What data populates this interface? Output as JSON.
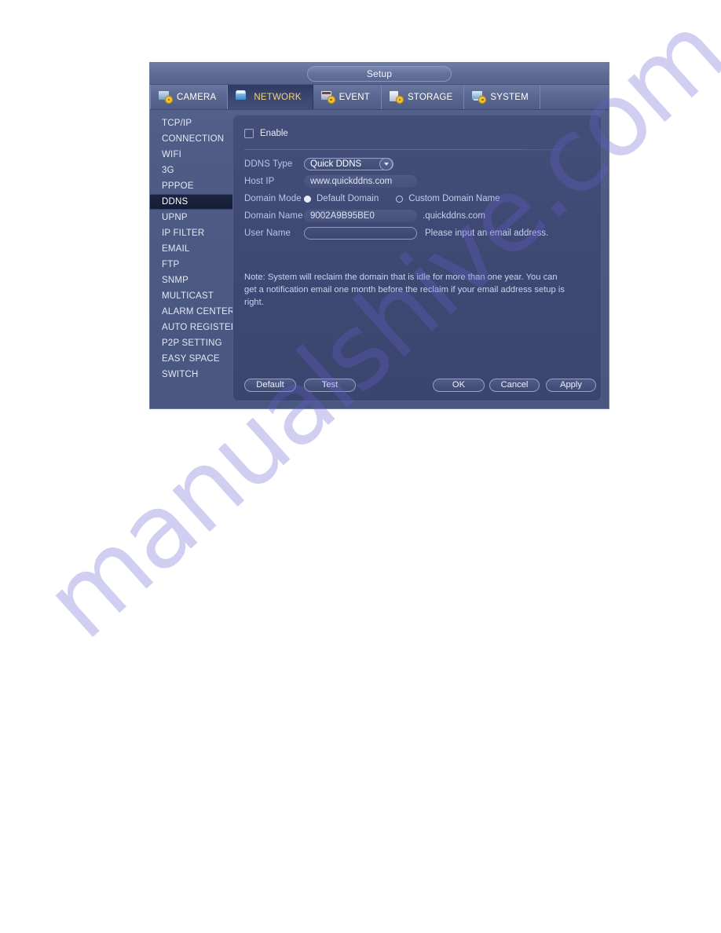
{
  "window": {
    "title": "Setup"
  },
  "tabs": [
    {
      "label": "CAMERA",
      "icon": "camera-icon",
      "active": false
    },
    {
      "label": "NETWORK",
      "icon": "network-icon",
      "active": true
    },
    {
      "label": "EVENT",
      "icon": "event-icon",
      "active": false
    },
    {
      "label": "STORAGE",
      "icon": "storage-icon",
      "active": false
    },
    {
      "label": "SYSTEM",
      "icon": "system-icon",
      "active": false
    }
  ],
  "sidebar": {
    "items": [
      {
        "label": "TCP/IP",
        "active": false
      },
      {
        "label": "CONNECTION",
        "active": false
      },
      {
        "label": "WIFI",
        "active": false
      },
      {
        "label": "3G",
        "active": false
      },
      {
        "label": "PPPOE",
        "active": false
      },
      {
        "label": "DDNS",
        "active": true
      },
      {
        "label": "UPNP",
        "active": false
      },
      {
        "label": "IP FILTER",
        "active": false
      },
      {
        "label": "EMAIL",
        "active": false
      },
      {
        "label": "FTP",
        "active": false
      },
      {
        "label": "SNMP",
        "active": false
      },
      {
        "label": "MULTICAST",
        "active": false
      },
      {
        "label": "ALARM CENTER",
        "active": false
      },
      {
        "label": "AUTO REGISTER",
        "active": false
      },
      {
        "label": "P2P SETTING",
        "active": false
      },
      {
        "label": "EASY SPACE",
        "active": false
      },
      {
        "label": "SWITCH",
        "active": false
      }
    ]
  },
  "form": {
    "enable": {
      "label": "Enable",
      "checked": false
    },
    "ddns_type": {
      "label": "DDNS Type",
      "value": "Quick DDNS"
    },
    "host_ip": {
      "label": "Host IP",
      "value": "www.quickddns.com"
    },
    "domain_mode": {
      "label": "Domain Mode",
      "options": [
        {
          "label": "Default Domain",
          "selected": true
        },
        {
          "label": "Custom Domain Name",
          "selected": false
        }
      ]
    },
    "domain_name": {
      "label": "Domain Name",
      "value": "9002A9B95BE0",
      "suffix": ".quickddns.com"
    },
    "user_name": {
      "label": "User Name",
      "value": "",
      "hint": "Please input an email address."
    },
    "note": "Note: System will reclaim the domain that is idle for more than one year. You can get a notification email one month before the reclaim if your email address setup is right."
  },
  "buttons": {
    "default": "Default",
    "test": "Test",
    "ok": "OK",
    "cancel": "Cancel",
    "apply": "Apply"
  },
  "watermark": {
    "text": "manualshive.com"
  },
  "colors": {
    "window_bg": "#4e5c86",
    "panel_bg": "#3e4a73",
    "tab_active_bg": "#3b4770",
    "tab_active_text": "#f4d47a",
    "sidebar_active_bg": "#161d36",
    "label_text": "#b9c4e6",
    "value_text": "#ffffff",
    "accent_gear": "#f0c431",
    "watermark": "#6860d2"
  }
}
